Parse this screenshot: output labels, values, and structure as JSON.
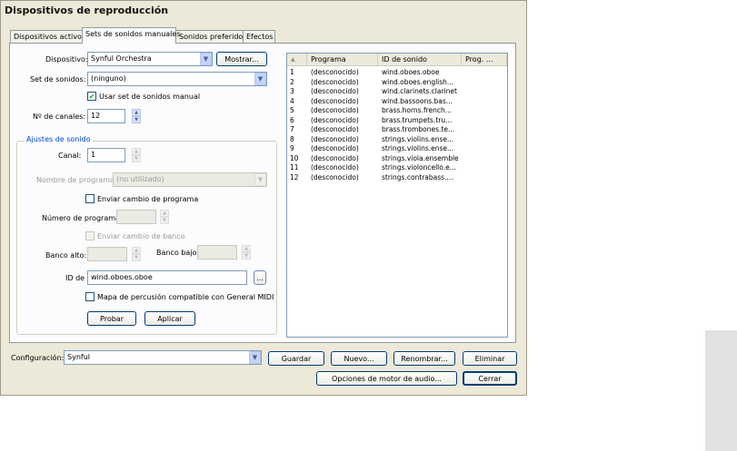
{
  "window": {
    "title": "Dispositivos de reproducción"
  },
  "tabs": [
    "Dispositivos activos",
    "Sets de sonidos manuales",
    "Sonidos preferidos",
    "Efectos"
  ],
  "device": {
    "label": "Dispositivo:",
    "value": "Synful Orchestra",
    "show_button": "Mostrar..."
  },
  "soundset": {
    "label": "Set de sonidos:",
    "value": "(ninguno)",
    "manual_checkbox": "Usar set de sonidos manual"
  },
  "channels": {
    "label": "Nº de canales:",
    "value": "12"
  },
  "adjust": {
    "legend": "Ajustes de sonido",
    "channel_label": "Canal:",
    "channel_value": "1",
    "program_name_label": "Nombre de programa:",
    "program_name_value": "(no utilizado)",
    "send_program_change": "Enviar cambio de programa",
    "program_number_label": "Número de programa:",
    "send_bank_change": "Enviar cambio de banco",
    "bank_high_label": "Banco alto:",
    "bank_low_label": "Banco bajo:",
    "id_label": "ID de",
    "id_value": "wind.oboes.oboe",
    "browse_button": "...",
    "percussion_map": "Mapa de percusión compatible con General MIDI",
    "test_button": "Probar",
    "apply_button": "Aplicar"
  },
  "list": {
    "sort_indicator": "▲",
    "columns": [
      "Programa",
      "ID de sonido",
      "Prog. ..."
    ],
    "rows": [
      {
        "n": "1",
        "prog": "(desconocido)",
        "id": "wind.oboes.oboe"
      },
      {
        "n": "2",
        "prog": "(desconocido)",
        "id": "wind.oboes.english..."
      },
      {
        "n": "3",
        "prog": "(desconocido)",
        "id": "wind.clarinets.clarinet"
      },
      {
        "n": "4",
        "prog": "(desconocido)",
        "id": "wind.bassoons.bas..."
      },
      {
        "n": "5",
        "prog": "(desconocido)",
        "id": "brass.horns.french..."
      },
      {
        "n": "6",
        "prog": "(desconocido)",
        "id": "brass.trumpets.tru..."
      },
      {
        "n": "7",
        "prog": "(desconocido)",
        "id": "brass.trombones.te..."
      },
      {
        "n": "8",
        "prog": "(desconocido)",
        "id": "strings.violins.ense..."
      },
      {
        "n": "9",
        "prog": "(desconocido)",
        "id": "strings.violins.ense..."
      },
      {
        "n": "10",
        "prog": "(desconocido)",
        "id": "strings.viola.ensemble"
      },
      {
        "n": "11",
        "prog": "(desconocido)",
        "id": "strings.violoncello.e..."
      },
      {
        "n": "12",
        "prog": "(desconocido)",
        "id": "strings.contrabass...."
      }
    ]
  },
  "config": {
    "label": "Configuración:",
    "value": "Synful"
  },
  "buttons": {
    "save": "Guardar",
    "new": "Nuevo...",
    "rename": "Renombrar...",
    "delete": "Eliminar",
    "audio_engine": "Opciones de motor de audio...",
    "close": "Cerrar"
  }
}
